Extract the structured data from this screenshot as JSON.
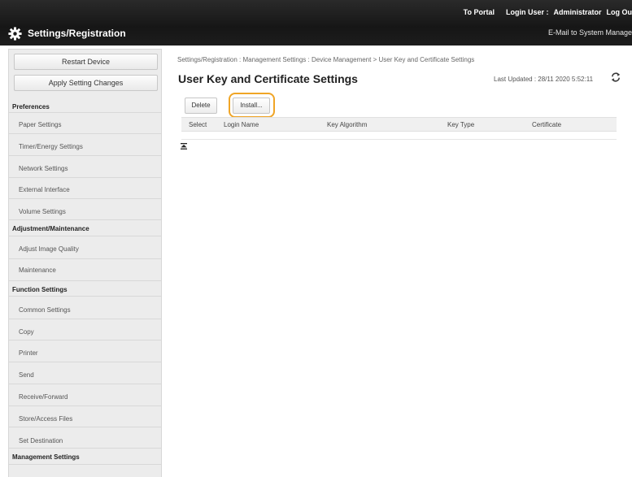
{
  "header": {
    "to_portal": "To Portal",
    "login_user_label": "Login User :",
    "user": "Administrator",
    "logout": "Log Ou",
    "app_title": "Settings/Registration",
    "email_admin": "E-Mail to System Manage"
  },
  "sidebar": {
    "restart": "Restart Device",
    "apply": "Apply Setting Changes",
    "sections": [
      {
        "title": "Preferences",
        "items": [
          "Paper Settings",
          "Timer/Energy Settings",
          "Network Settings",
          "External Interface",
          "Volume Settings"
        ]
      },
      {
        "title": "Adjustment/Maintenance",
        "items": [
          "Adjust Image Quality",
          "Maintenance"
        ]
      },
      {
        "title": "Function Settings",
        "items": [
          "Common Settings",
          "Copy",
          "Printer",
          "Send",
          "Receive/Forward",
          "Store/Access Files"
        ]
      },
      {
        "title": "",
        "items": [
          "Set Destination"
        ]
      },
      {
        "title": "Management Settings",
        "items": []
      }
    ]
  },
  "main": {
    "breadcrumb": "Settings/Registration : Management Settings : Device Management > User Key and Certificate Settings",
    "title": "User Key and Certificate Settings",
    "last_updated": "Last Updated : 28/11 2020 5:52:11",
    "buttons": {
      "delete": "Delete",
      "install": "Install..."
    },
    "columns": [
      "Select",
      "Login Name",
      "Key Algorithm",
      "Key Type",
      "Certificate"
    ]
  }
}
